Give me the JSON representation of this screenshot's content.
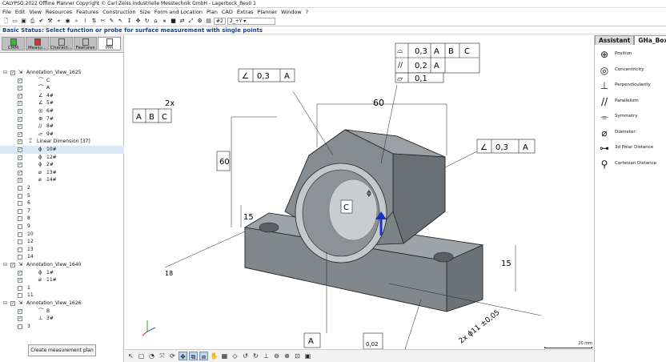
{
  "window": {
    "title": "CALYPSO 2022 Offline Planner Copyright © Carl Zeiss Industrielle Messtechnik GmbH - Lagerbock_Rev0 1"
  },
  "menu": [
    "File",
    "Edit",
    "View",
    "Resources",
    "Features",
    "Construction",
    "Size",
    "Form and Location",
    "Plan",
    "CAD",
    "Extras",
    "Planner",
    "Window",
    "?"
  ],
  "toolbar": {
    "icons": [
      "new-icon",
      "open-icon",
      "save-icon",
      "print-icon",
      "check-icon",
      "tool-icon",
      "measure-icon",
      "camera-icon",
      "search-icon",
      "plot-icon",
      "align-icon",
      "cut-icon",
      "edit-icon",
      "pointer-icon",
      "probe-icon",
      "move-icon",
      "rotate-icon",
      "home-icon",
      "pause-icon",
      "stop-icon",
      "flip-icon",
      "scale-icon",
      "gear-icon",
      "chart-icon"
    ],
    "probe_select": "#2",
    "probe_value": "2_+Y"
  },
  "status": "Basic Status: Select function or probe for surface measurement with single points",
  "left_tabs": [
    {
      "label": "CMM",
      "color": "#2fbf2f"
    },
    {
      "label": "Measu...",
      "color": "#d63030"
    },
    {
      "label": "Charact...",
      "color": "#bfbfbf"
    },
    {
      "label": "Features",
      "color": "#bfbfbf"
    },
    {
      "label": "PMI",
      "color": "#ffffff"
    }
  ],
  "tree": [
    {
      "label": "Annotation_View_1625",
      "level": 0,
      "checked": true,
      "exp": "⊟",
      "icon": "⇲"
    },
    {
      "label": "C",
      "level": 2,
      "checked": true,
      "icon": "⌒"
    },
    {
      "label": "A",
      "level": 2,
      "checked": true,
      "icon": "⌒"
    },
    {
      "label": "4#",
      "level": 2,
      "checked": true,
      "icon": "∠"
    },
    {
      "label": "5#",
      "level": 2,
      "checked": true,
      "icon": "∠"
    },
    {
      "label": "6#",
      "level": 2,
      "checked": true,
      "icon": "◎"
    },
    {
      "label": "7#",
      "level": 2,
      "checked": true,
      "icon": "⊕"
    },
    {
      "label": "8#",
      "level": 2,
      "checked": true,
      "icon": "//"
    },
    {
      "label": "9#",
      "level": 2,
      "checked": true,
      "icon": "▱"
    },
    {
      "label": "Linear Dimension [37]",
      "level": 1,
      "checked": true,
      "exp": "⊟",
      "icon": "⌶"
    },
    {
      "label": "10#",
      "level": 2,
      "checked": true,
      "icon": "ϕ",
      "sel": true
    },
    {
      "label": "12#",
      "level": 2,
      "checked": true,
      "icon": "ϕ"
    },
    {
      "label": "2#",
      "level": 2,
      "checked": true,
      "icon": "ϕ"
    },
    {
      "label": "13#",
      "level": 2,
      "checked": true,
      "icon": "⌀"
    },
    {
      "label": "14#",
      "level": 2,
      "checked": true,
      "icon": "⌀"
    },
    {
      "label": "2",
      "level": 0,
      "checked": false
    },
    {
      "label": "5",
      "level": 0,
      "checked": false
    },
    {
      "label": "6",
      "level": 0,
      "checked": false
    },
    {
      "label": "7",
      "level": 0,
      "checked": false
    },
    {
      "label": "8",
      "level": 0,
      "checked": false
    },
    {
      "label": "9",
      "level": 0,
      "checked": false
    },
    {
      "label": "10",
      "level": 0,
      "checked": false
    },
    {
      "label": "12",
      "level": 0,
      "checked": false
    },
    {
      "label": "13",
      "level": 0,
      "checked": false
    },
    {
      "label": "14",
      "level": 0,
      "checked": false
    },
    {
      "label": "Annotation_View_1640",
      "level": 0,
      "checked": true,
      "exp": "⊟",
      "icon": "⇲"
    },
    {
      "label": "1#",
      "level": 2,
      "checked": true,
      "icon": "ϕ"
    },
    {
      "label": "11#",
      "level": 2,
      "checked": true,
      "icon": "⌀"
    },
    {
      "label": "1",
      "level": 0,
      "checked": false
    },
    {
      "label": "11",
      "level": 0,
      "checked": false
    },
    {
      "label": "Annotation_View_1626",
      "level": 0,
      "checked": true,
      "exp": "⊟",
      "icon": "⇲"
    },
    {
      "label": "B",
      "level": 2,
      "checked": true,
      "icon": "⌒"
    },
    {
      "label": "3#",
      "level": 2,
      "checked": true,
      "icon": "⊥"
    },
    {
      "label": "3",
      "level": 0,
      "checked": false
    }
  ],
  "create_button": "Create measurement plan",
  "right_tabs": [
    "Assistant",
    "GHa_Box"
  ],
  "right_items": [
    {
      "label": "Position",
      "icon": "⊕"
    },
    {
      "label": "Concentricity",
      "icon": "◎"
    },
    {
      "label": "Perpendicularity",
      "icon": "⊥"
    },
    {
      "label": "Parallelism",
      "icon": "//"
    },
    {
      "label": "Symmetry",
      "icon": "⌯"
    },
    {
      "label": "Diameter",
      "icon": "⌀"
    },
    {
      "label": "3d Polar Distance",
      "icon": "⊶"
    },
    {
      "label": "Cartesian Distance",
      "icon": "⚲"
    }
  ],
  "viewport": {
    "fcf_top": [
      [
        "0,3",
        "A",
        "B",
        "C"
      ],
      [
        "0,2",
        "A"
      ],
      [
        "0,1"
      ]
    ],
    "fcf_left": [
      "0,3",
      "A"
    ],
    "fcf_right": [
      "0,3",
      "A"
    ],
    "datum_group": [
      "A",
      "B",
      "C"
    ],
    "count_label": "2x",
    "dim_width": "60",
    "dim_height": "60",
    "dim_15_left": "15",
    "dim_15_right": "15",
    "datum_c": "C",
    "datum_a": "A",
    "dia_label": "ϕ",
    "bottom_box": "0,02",
    "hole_callout": "2x ϕ11 ±0,05",
    "bottom_left": "18",
    "scale_label": "20 mm"
  },
  "view_toolbar": [
    "select-icon",
    "cube-icon",
    "arc-icon",
    "zoom-fit-icon",
    "rotate-view-icon",
    "pan-icon",
    "view-icon",
    "sel-view-icon",
    "hand-icon",
    "grid-icon",
    "iso-icon",
    "refresh-icon",
    "refresh2-icon",
    "axis-icon",
    "zoom-out-icon",
    "zoom-in-icon",
    "zoom-box-icon",
    "window-icon"
  ]
}
